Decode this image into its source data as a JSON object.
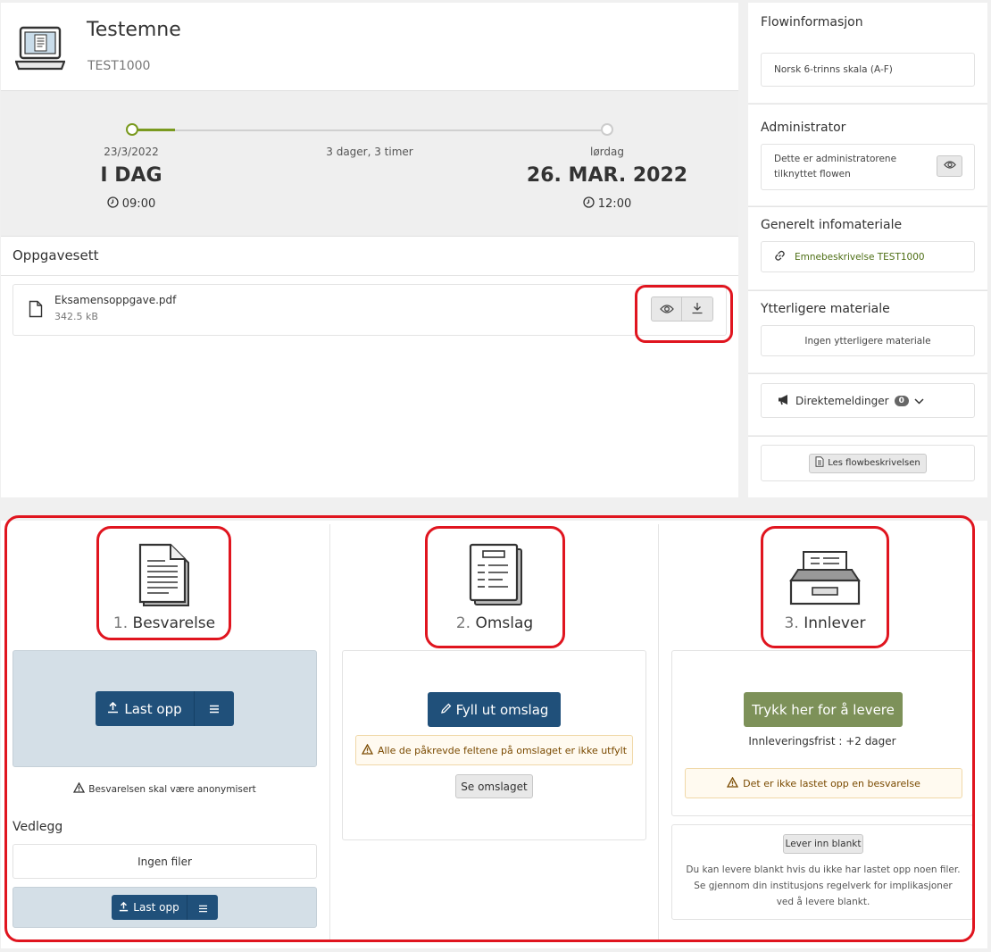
{
  "course": {
    "title": "Testemne",
    "code": "TEST1000"
  },
  "timeline": {
    "start_date": "23/3/2022",
    "start_label": "I DAG",
    "start_time": "09:00",
    "duration": "3 dager, 3 timer",
    "end_weekday": "lørdag",
    "end_label": "26. MAR. 2022",
    "end_time": "12:00",
    "progress_fraction": 0.09
  },
  "assignment_set": {
    "heading": "Oppgavesett",
    "file_name": "Eksamensoppgave.pdf",
    "file_size": "342.5 kB"
  },
  "sidebar": {
    "flow_title": "Flowinformasjon",
    "grading_scale": "Norsk 6-trinns skala (A-F)",
    "admin_title": "Administrator",
    "admin_text": "Dette er administratorene tilknyttet flowen",
    "info_title": "Generelt infomateriale",
    "info_link": "Emnebeskrivelse TEST1000",
    "extra_title": "Ytterligere materiale",
    "extra_text": "Ingen ytterligere materiale",
    "messages_label": "Direktemeldinger",
    "messages_count": "0",
    "flow_desc_button": "Les flowbeskrivelsen"
  },
  "steps": {
    "step1": {
      "number": "1.",
      "title": "Besvarelse",
      "upload_label": "Last opp",
      "anon_warning": "Besvarelsen skal være anonymisert",
      "attachments_title": "Vedlegg",
      "no_files": "Ingen filer",
      "attach_upload_label": "Last opp"
    },
    "step2": {
      "number": "2.",
      "title": "Omslag",
      "fill_label": "Fyll ut omslag",
      "warning": "Alle de påkrevde feltene på omslaget er ikke utfylt",
      "view_label": "Se omslaget"
    },
    "step3": {
      "number": "3.",
      "title": "Innlever",
      "submit_label": "Trykk her for å levere",
      "deadline": "Innleveringsfrist : +2 dager",
      "warning": "Det er ikke lastet opp en besvarelse",
      "blank_label": "Lever inn blankt",
      "blank_text": "Du kan levere blankt hvis du ikke har lastet opp noen filer. Se gjennom din institusjons regelverk for implikasjoner ved å levere blankt."
    }
  },
  "colors": {
    "accent_green": "#7a9a1f",
    "primary_blue": "#20507a",
    "submit_green": "#7d9159",
    "highlight_red": "#e0151f"
  }
}
